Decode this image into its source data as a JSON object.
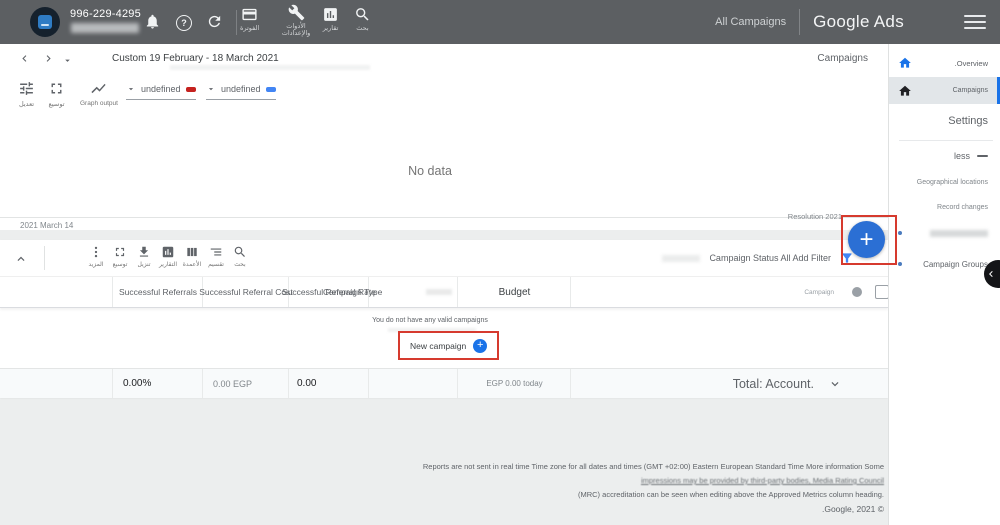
{
  "colors": {
    "topbar_gray": "#5c5f62",
    "accent_blue": "#1a73e8",
    "fab_blue": "#2b6fd4",
    "annotation_red": "#d63a2e",
    "series_red": "#c5221f",
    "series_blue": "#4285f4"
  },
  "topbar": {
    "account_id": "996-229-4295",
    "all_campaigns_label": "All Campaigns",
    "product_name": "Google Ads",
    "nav_items": [
      {
        "icon": "billing-card-icon",
        "label": "الفوترة"
      },
      {
        "icon": "tools-wrench-icon",
        "label": "الأدوات والإعدادات"
      },
      {
        "icon": "reports-chart-icon",
        "label": "تقارير"
      },
      {
        "icon": "search-icon",
        "label": "بحث"
      }
    ]
  },
  "datebar": {
    "date_range": "Custom 19 February - 18 March 2021",
    "page_title": "Campaigns"
  },
  "chart_panel": {
    "tools": [
      {
        "icon": "tune-icon",
        "label": "تعديل"
      },
      {
        "icon": "expand-icon",
        "label": "توسيع"
      },
      {
        "icon": "line-chart-icon",
        "label": "Graph output"
      }
    ],
    "series_selectors": [
      {
        "value": "undefined",
        "color": "#c5221f"
      },
      {
        "value": "undefined",
        "color": "#4285f4"
      }
    ],
    "empty_text": "No data",
    "axis_start_label": "2021 March 14",
    "resolution_label": "Resolution 2021"
  },
  "fab": {
    "plus": "+"
  },
  "table": {
    "toolbar": {
      "items": [
        {
          "icon": "more-icon",
          "label": "المزيد"
        },
        {
          "icon": "expand-icon",
          "label": "توسيع"
        },
        {
          "icon": "download-icon",
          "label": "تنزيل"
        },
        {
          "icon": "reports-icon",
          "label": "التقارير"
        },
        {
          "icon": "columns-icon",
          "label": "الأعمدة"
        },
        {
          "icon": "segment-icon",
          "label": "تقسيم"
        },
        {
          "icon": "search-icon",
          "label": "بحث"
        }
      ],
      "filter_bar_text": "Campaign Status All Add Filter"
    },
    "columns": {
      "successful_referrals": "Successful Referrals",
      "successful_referral_cost": "Successful Referral Cost",
      "successful_referral_rate": "Successful Referral Rate",
      "campaign_type": "Campaign Type",
      "budget": "Budget",
      "campaign": "Campaign"
    },
    "empty_state": {
      "message": "You do not have any valid campaigns",
      "button_label": "New campaign"
    },
    "totals_row": {
      "rate": "0.00%",
      "cost": "0.00 EGP",
      "referrals": "0.00",
      "budget": "EGP 0.00 today",
      "label": "Total: Account."
    }
  },
  "sidebar": {
    "overview": ".Overview",
    "campaigns": "Campaigns",
    "settings": "Settings",
    "less": "less",
    "geographical_locations": "Geographical locations",
    "record_changes": "Record changes",
    "campaign_groups": "Campaign Groups"
  },
  "footer": {
    "line1": "Reports are not sent in real time Time zone for all dates and times (GMT +02:00) Eastern European Standard Time More information Some",
    "line2": "impressions may be provided by third-party bodies, Media Rating Council",
    "line3": "(MRC) accreditation can be seen when editing above the Approved Metrics column heading.",
    "copyright": ".Google, 2021 ©"
  }
}
